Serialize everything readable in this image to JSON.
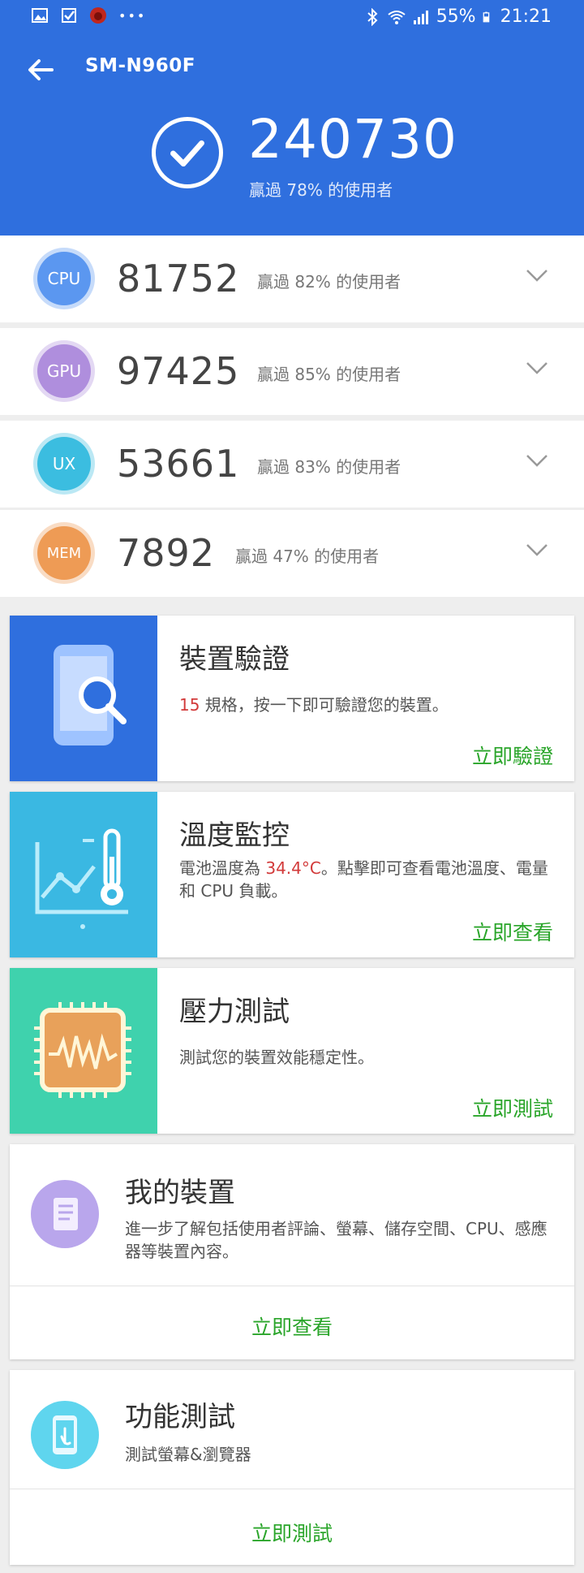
{
  "status_bar": {
    "battery": "55%",
    "time": "21:21",
    "more": "•••"
  },
  "header": {
    "title": "SM-N960F",
    "total_score": "240730",
    "total_caption": "贏過 78% 的使用者"
  },
  "scores": [
    {
      "label": "CPU",
      "score": "81752",
      "caption": "贏過 82% 的使用者",
      "color": "#5b97f0"
    },
    {
      "label": "GPU",
      "score": "97425",
      "caption": "贏過 85% 的使用者",
      "color": "#b08ede"
    },
    {
      "label": "UX",
      "score": "53661",
      "caption": "贏過 83% 的使用者",
      "color": "#3bbde0"
    },
    {
      "label": "MEM",
      "score": "7892",
      "caption": "贏過 47% 的使用者",
      "color": "#ee9c55"
    }
  ],
  "cards": {
    "verify": {
      "title": "裝置驗證",
      "count": "15",
      "desc": " 規格，按一下即可驗證您的裝置。",
      "action": "立即驗證",
      "color": "#2f6fde"
    },
    "temp": {
      "title": "溫度監控",
      "desc_pre": "電池溫度為 ",
      "temp_value": "34.4°C",
      "desc_post": "。點擊即可查看電池溫度、電量和 CPU 負載。",
      "action": "立即查看",
      "color": "#3ab8e2"
    },
    "stress": {
      "title": "壓力測試",
      "desc": "測試您的裝置效能穩定性。",
      "action": "立即測試",
      "color": "#3fd2ad"
    },
    "mydevice": {
      "title": "我的裝置",
      "desc": "進一步了解包括使用者評論、螢幕、儲存空間、CPU、感應器等裝置內容。",
      "action": "立即查看",
      "color": "#b9a6ec"
    },
    "functest": {
      "title": "功能測試",
      "desc": "測試螢幕&瀏覽器",
      "action": "立即測試",
      "color": "#5fd5ee"
    }
  }
}
